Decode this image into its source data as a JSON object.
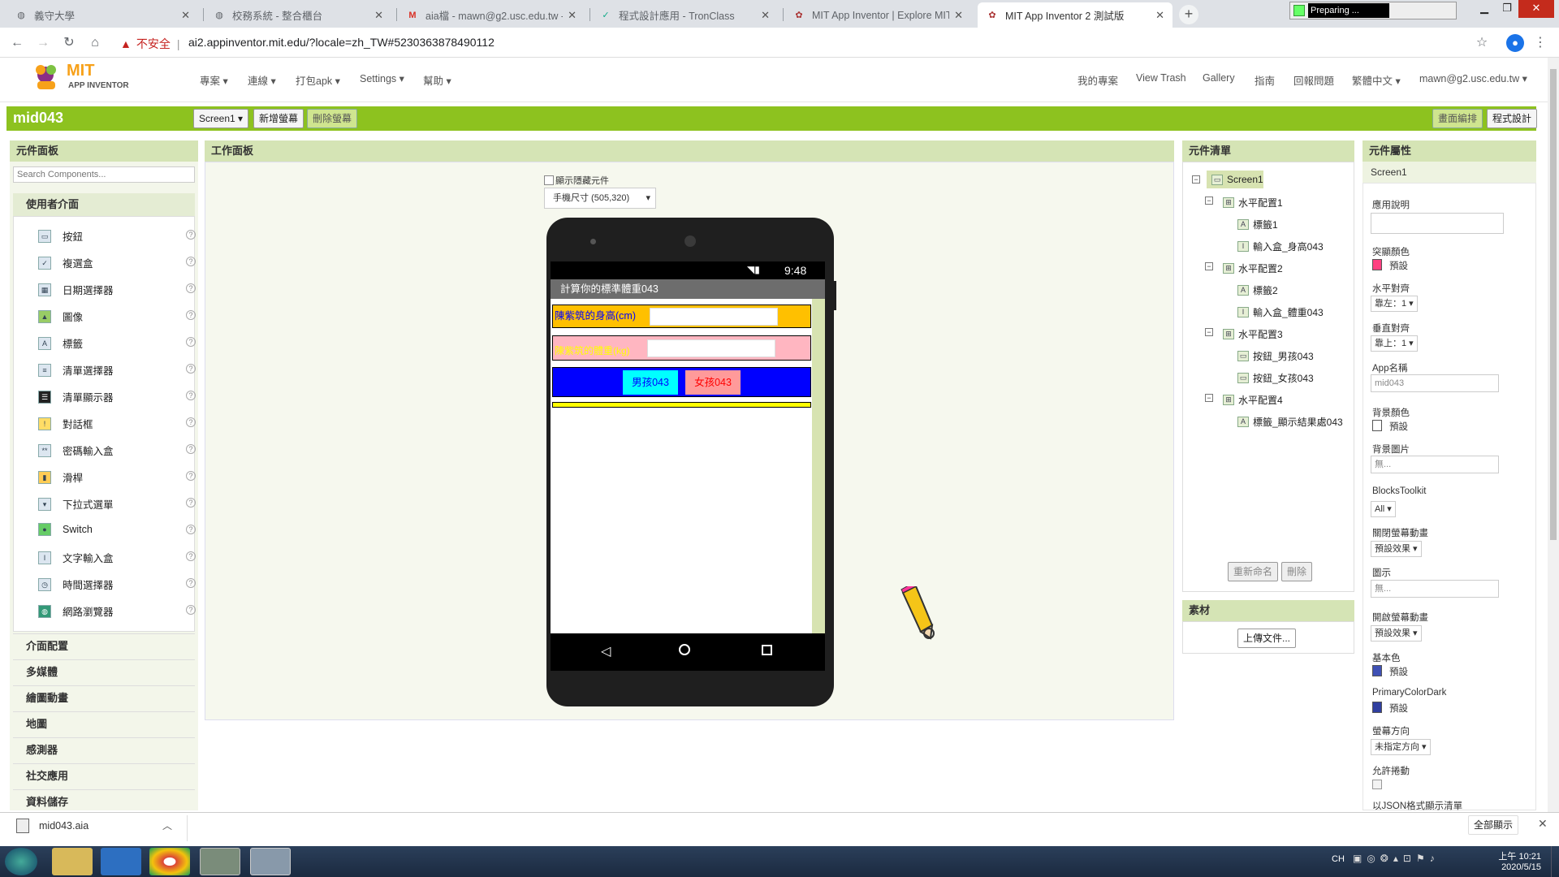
{
  "browser": {
    "tabs": [
      {
        "title": "義守大學",
        "icon": "globe-icon"
      },
      {
        "title": "校務系統 - 整合櫃台",
        "icon": "globe-icon"
      },
      {
        "title": "aia檔 - mawn@g2.usc.edu.tw -",
        "icon": "gmail-icon"
      },
      {
        "title": "程式設計應用 - TronClass",
        "icon": "tronclass-icon"
      },
      {
        "title": "MIT App Inventor | Explore MIT",
        "icon": "appinventor-icon"
      },
      {
        "title": "MIT App Inventor 2 測試版",
        "icon": "appinventor-icon"
      }
    ],
    "preparing": "Preparing ...",
    "not_secure": "不安全",
    "url": "ai2.appinventor.mit.edu/?locale=zh_TW#5230363878490112"
  },
  "app": {
    "logo_top": "MIT",
    "logo_bottom": "APP INVENTOR",
    "menus": [
      "專案",
      "連線",
      "打包apk",
      "Settings",
      "幫助"
    ],
    "right_links": [
      "我的專案",
      "View Trash",
      "Gallery",
      "指南",
      "回報問題",
      "繁體中文",
      "mawn@g2.usc.edu.tw"
    ],
    "project_name": "mid043",
    "screen_select": "Screen1",
    "add_screen": "新增螢幕",
    "remove_screen": "刪除螢幕",
    "designer_btn": "畫面編排",
    "blocks_btn": "程式設計"
  },
  "palette": {
    "header": "元件面板",
    "search_placeholder": "Search Components...",
    "section": "使用者介面",
    "items": [
      "按鈕",
      "複選盒",
      "日期選擇器",
      "圖像",
      "標籤",
      "清單選擇器",
      "清單顯示器",
      "對話框",
      "密碼輸入盒",
      "滑桿",
      "下拉式選單",
      "Switch",
      "文字輸入盒",
      "時間選擇器",
      "網路瀏覽器"
    ],
    "categories": [
      "介面配置",
      "多媒體",
      "繪圖動畫",
      "地圖",
      "感測器",
      "社交應用",
      "資料儲存"
    ]
  },
  "viewer": {
    "header": "工作面板",
    "show_hidden": "顯示隱藏元件",
    "size_select": "手機尺寸 (505,320)",
    "time": "9:48",
    "app_title": "計算你的標準體重043",
    "height_label": "陳紫筑的身高(cm)",
    "weight_label": "陳紫筑的體重(kg)",
    "boy_btn": "男孩043",
    "girl_btn": "女孩043"
  },
  "components": {
    "header": "元件清單",
    "tree": [
      {
        "label": "Screen1",
        "level": 0,
        "toggle": "⊟",
        "icon": "screen-icon"
      },
      {
        "label": "水平配置1",
        "level": 1,
        "toggle": "⊟",
        "icon": "arrangement-icon"
      },
      {
        "label": "標籤1",
        "level": 2,
        "icon": "label-icon"
      },
      {
        "label": "輸入盒_身高043",
        "level": 2,
        "icon": "textbox-icon"
      },
      {
        "label": "水平配置2",
        "level": 1,
        "toggle": "⊟",
        "icon": "arrangement-icon"
      },
      {
        "label": "標籤2",
        "level": 2,
        "icon": "label-icon"
      },
      {
        "label": "輸入盒_體重043",
        "level": 2,
        "icon": "textbox-icon"
      },
      {
        "label": "水平配置3",
        "level": 1,
        "toggle": "⊟",
        "icon": "arrangement-icon"
      },
      {
        "label": "按鈕_男孩043",
        "level": 2,
        "icon": "button-icon"
      },
      {
        "label": "按鈕_女孩043",
        "level": 2,
        "icon": "button-icon"
      },
      {
        "label": "水平配置4",
        "level": 1,
        "toggle": "⊟",
        "icon": "arrangement-icon"
      },
      {
        "label": "標籤_顯示結果處043",
        "level": 2,
        "icon": "label-icon"
      }
    ],
    "rename": "重新命名",
    "delete": "刪除",
    "media_header": "素材",
    "upload": "上傳文件..."
  },
  "properties": {
    "header": "元件屬性",
    "component": "Screen1",
    "about_label": "應用說明",
    "accent_label": "突顯顏色",
    "accent_value": "預設",
    "halign_label": "水平對齊",
    "halign_value": "靠左：1",
    "valign_label": "垂直對齊",
    "valign_value": "靠上：1",
    "appname_label": "App名稱",
    "appname_value": "mid043",
    "bgcolor_label": "背景顏色",
    "bgcolor_value": "預設",
    "bgimage_label": "背景圖片",
    "bgimage_value": "無...",
    "blocks_toolkit_label": "BlocksToolkit",
    "blocks_toolkit_value": "All",
    "close_anim_label": "關閉螢幕動畫",
    "close_anim_value": "預設效果",
    "icon_label": "圖示",
    "icon_value": "無...",
    "open_anim_label": "開啟螢幕動畫",
    "open_anim_value": "預設效果",
    "primary_label": "基本色",
    "primary_value": "預設",
    "primary_dark_label": "PrimaryColorDark",
    "primary_dark_value": "預設",
    "orientation_label": "螢幕方向",
    "orientation_value": "未指定方向",
    "scrollable_label": "允許捲動",
    "json_label": "以JSON格式顯示清單"
  },
  "download": {
    "file": "mid043.aia",
    "show_all": "全部顯示"
  },
  "taskbar": {
    "lang": "CH",
    "time": "上午 10:21",
    "date": "2020/5/15"
  },
  "colors": {
    "green_bar": "#8dc21f",
    "row1": "#ffc000",
    "row2": "#ffb6c1",
    "row3": "#0000ff",
    "boy_btn": "#00ffff",
    "girl_btn": "#ff9a9a",
    "label_blue": "#0000ff",
    "label_yellow": "#ffff00"
  }
}
